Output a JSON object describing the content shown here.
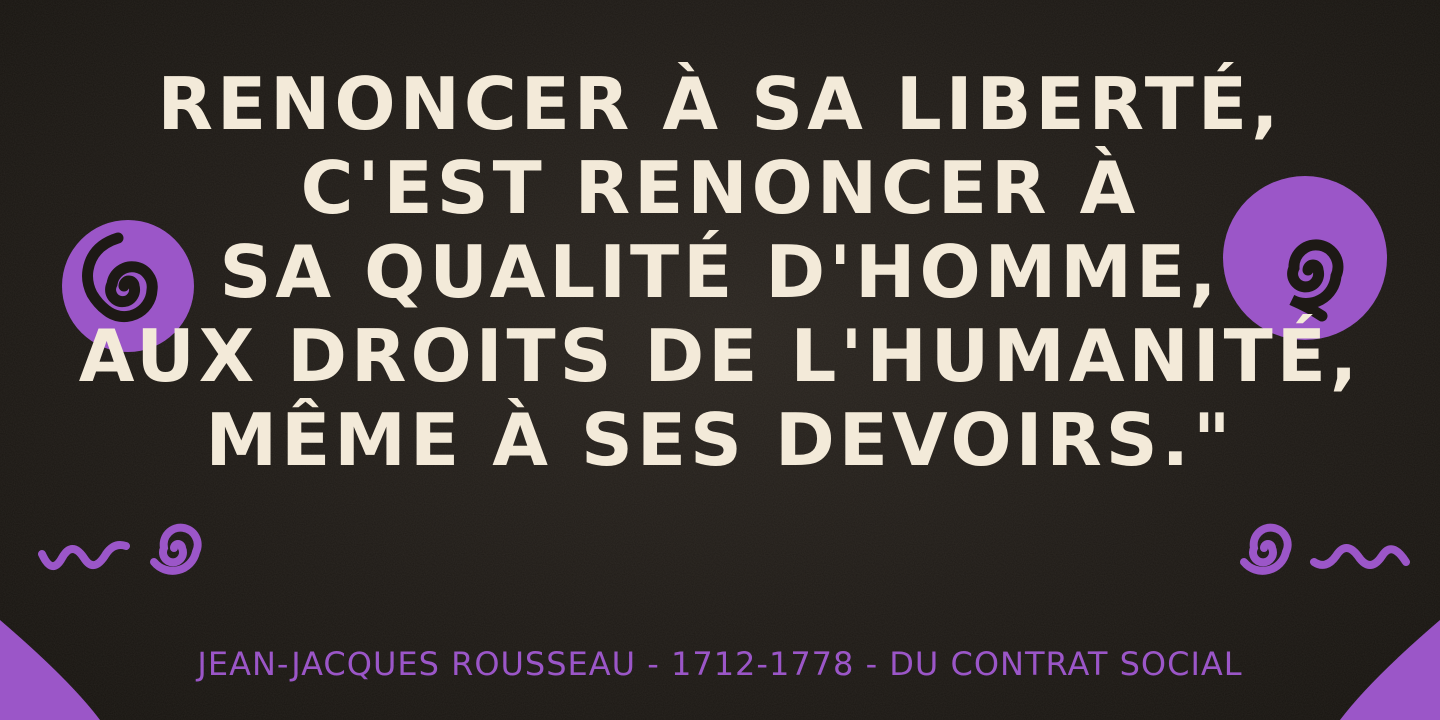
{
  "quote": {
    "lines": [
      "Renoncer à sa liberté,",
      "c'est renoncer à",
      "sa qualité d'homme,",
      "aux droits de l'humanité,",
      "même à ses devoirs.\""
    ]
  },
  "attribution": "Jean-Jacques Rousseau - 1712-1778 - Du Contrat Social",
  "colors": {
    "background": "#1d1915",
    "text": "#f3ead9",
    "accent": "#9b56c8"
  },
  "decorations": {
    "left_large": "spiral-circle-icon",
    "right_large": "spiral-circle-icon",
    "left_small": "spiral-squiggle-icon",
    "right_small": "spiral-squiggle-icon",
    "corners": "corner-wedge-icon"
  }
}
